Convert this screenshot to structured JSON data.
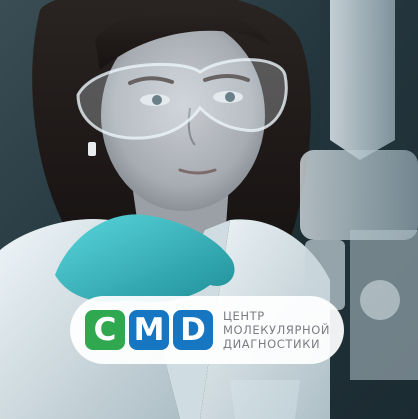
{
  "logo": {
    "letters": [
      {
        "char": "C",
        "color": "#2fa84f"
      },
      {
        "char": "M",
        "color": "#1676c2"
      },
      {
        "char": "D",
        "color": "#1676c2"
      }
    ],
    "text_lines": [
      "ЦЕНТР",
      "МОЛЕКУЛЯРНОЙ",
      "ДИАГНОСТИКИ"
    ]
  },
  "photo": {
    "subject": "scientist-in-safety-goggles-with-microscope"
  },
  "colors": {
    "background": "#1b2a30",
    "glove": "#3fc1c9",
    "coat": "#e4eef2",
    "green": "#2fa84f",
    "blue": "#1676c2",
    "logo_text": "#7a7d82"
  }
}
